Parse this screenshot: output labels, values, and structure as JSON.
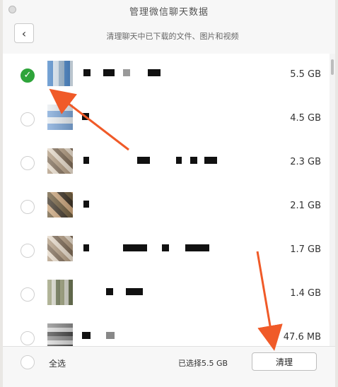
{
  "title": "管理微信聊天数据",
  "subtitle": "清理聊天中已下载的文件、图片和视频",
  "back_icon": "chevron-left-icon",
  "colors": {
    "accent": "#2ea43a",
    "annotation": "#f05a28"
  },
  "list": [
    {
      "size": "5.5 GB",
      "selected": true
    },
    {
      "size": "4.5 GB",
      "selected": false
    },
    {
      "size": "2.3 GB",
      "selected": false
    },
    {
      "size": "2.1 GB",
      "selected": false
    },
    {
      "size": "1.7 GB",
      "selected": false
    },
    {
      "size": "1.4 GB",
      "selected": false
    },
    {
      "size": "47.6 MB",
      "selected": false
    }
  ],
  "footer": {
    "select_all": "全选",
    "selected_summary": "已选择5.5 GB",
    "clean_button": "清理"
  }
}
